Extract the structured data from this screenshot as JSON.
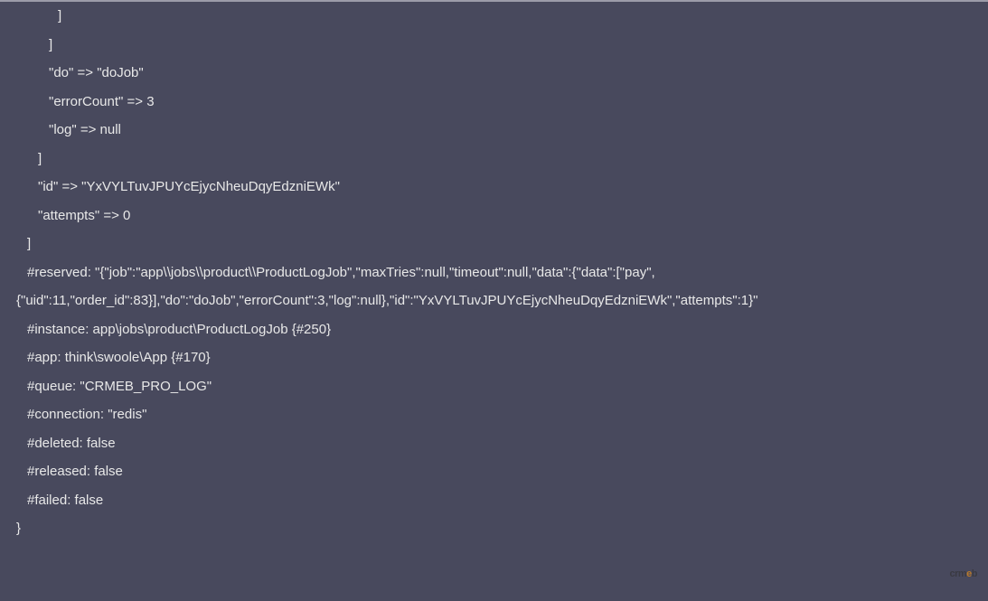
{
  "lines": [
    {
      "indent": 4,
      "text": "]"
    },
    {
      "indent": 3,
      "text": "]"
    },
    {
      "indent": 3,
      "text": "\"do\" => \"doJob\""
    },
    {
      "indent": 3,
      "text": "\"errorCount\" => 3"
    },
    {
      "indent": 3,
      "text": "\"log\" => null"
    },
    {
      "indent": 2,
      "text": "]"
    },
    {
      "indent": 2,
      "text": "\"id\" => \"YxVYLTuvJPUYcEjycNheuDqyEdzniEWk\""
    },
    {
      "indent": 2,
      "text": "\"attempts\" => 0"
    },
    {
      "indent": 1,
      "text": "]"
    },
    {
      "indent": 1,
      "text": "#reserved: \"{\"job\":\"app\\\\jobs\\\\product\\\\ProductLogJob\",\"maxTries\":null,\"timeout\":null,\"data\":{\"data\":[\"pay\","
    },
    {
      "indent": 0,
      "text": "{\"uid\":11,\"order_id\":83}],\"do\":\"doJob\",\"errorCount\":3,\"log\":null},\"id\":\"YxVYLTuvJPUYcEjycNheuDqyEdzniEWk\",\"attempts\":1}\""
    },
    {
      "indent": 1,
      "text": "#instance: app\\jobs\\product\\ProductLogJob {#250}"
    },
    {
      "indent": 1,
      "text": "#app: think\\swoole\\App {#170}"
    },
    {
      "indent": 1,
      "text": "#queue: \"CRMEB_PRO_LOG\""
    },
    {
      "indent": 1,
      "text": "#connection: \"redis\""
    },
    {
      "indent": 1,
      "text": "#deleted: false"
    },
    {
      "indent": 1,
      "text": "#released: false"
    },
    {
      "indent": 1,
      "text": "#failed: false"
    },
    {
      "indent": 0,
      "text": "}"
    }
  ],
  "watermark": {
    "prefix": "cr",
    "mid": "m",
    "orange": "e",
    "suffix": "b"
  }
}
